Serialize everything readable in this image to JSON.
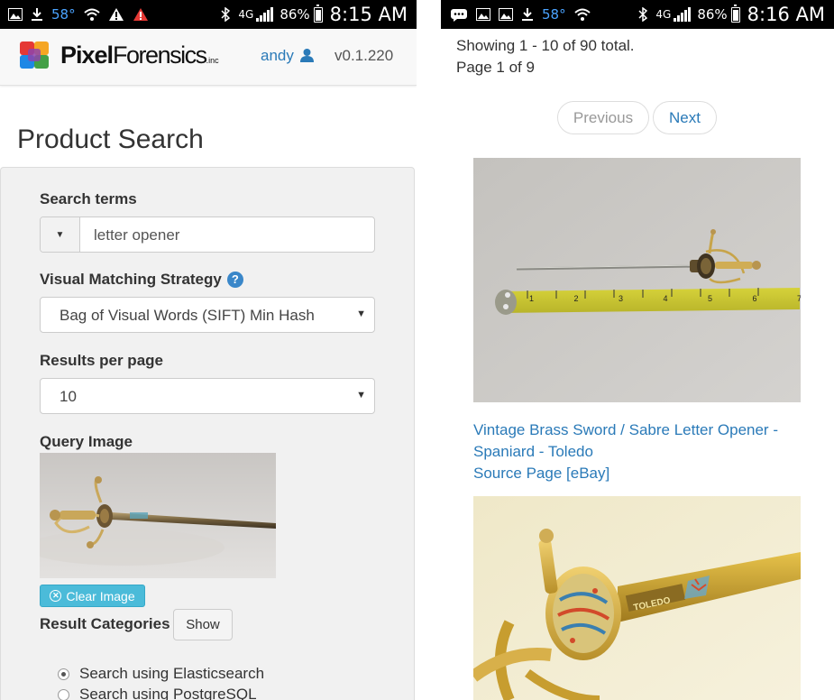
{
  "left_status": {
    "temp": "58°",
    "network": "4G",
    "battery": "86%",
    "time": "8:15 AM"
  },
  "right_status": {
    "temp": "58°",
    "network": "4G",
    "battery": "86%",
    "time": "8:16 AM"
  },
  "brand": {
    "pixel": "Pixel",
    "forensics": "Forensics",
    "inc": ".inc"
  },
  "nav": {
    "user": "andy",
    "version": "v0.1.220"
  },
  "page_title": "Product Search",
  "form": {
    "search_label": "Search terms",
    "search_value": "letter opener",
    "strategy_label": "Visual Matching Strategy",
    "strategy_value": "Bag of Visual Words (SIFT) Min Hash",
    "results_label": "Results per page",
    "results_value": "10",
    "query_image_label": "Query Image",
    "clear_image": "Clear Image",
    "categories_label": "Result Categories",
    "show_button": "Show",
    "radio_elastic": "Search using Elasticsearch",
    "radio_postgres": "Search using PostgreSQL"
  },
  "results": {
    "showing": "Showing 1 - 10 of 90 total.",
    "page": "Page 1 of 9",
    "previous": "Previous",
    "next": "Next",
    "item1_title_line1": "Vintage Brass Sword / Sabre Letter Opener -",
    "item1_title_line2": "Spaniard - Toledo",
    "item1_source": "Source Page [eBay]",
    "ruler_numbers": "1 2 3 4 5 6 7 8",
    "sword_text": "TOLEDO"
  },
  "colors": {
    "link": "#2a7ab8",
    "accent": "#4bbbd9",
    "temp": "#4aa3ff"
  }
}
